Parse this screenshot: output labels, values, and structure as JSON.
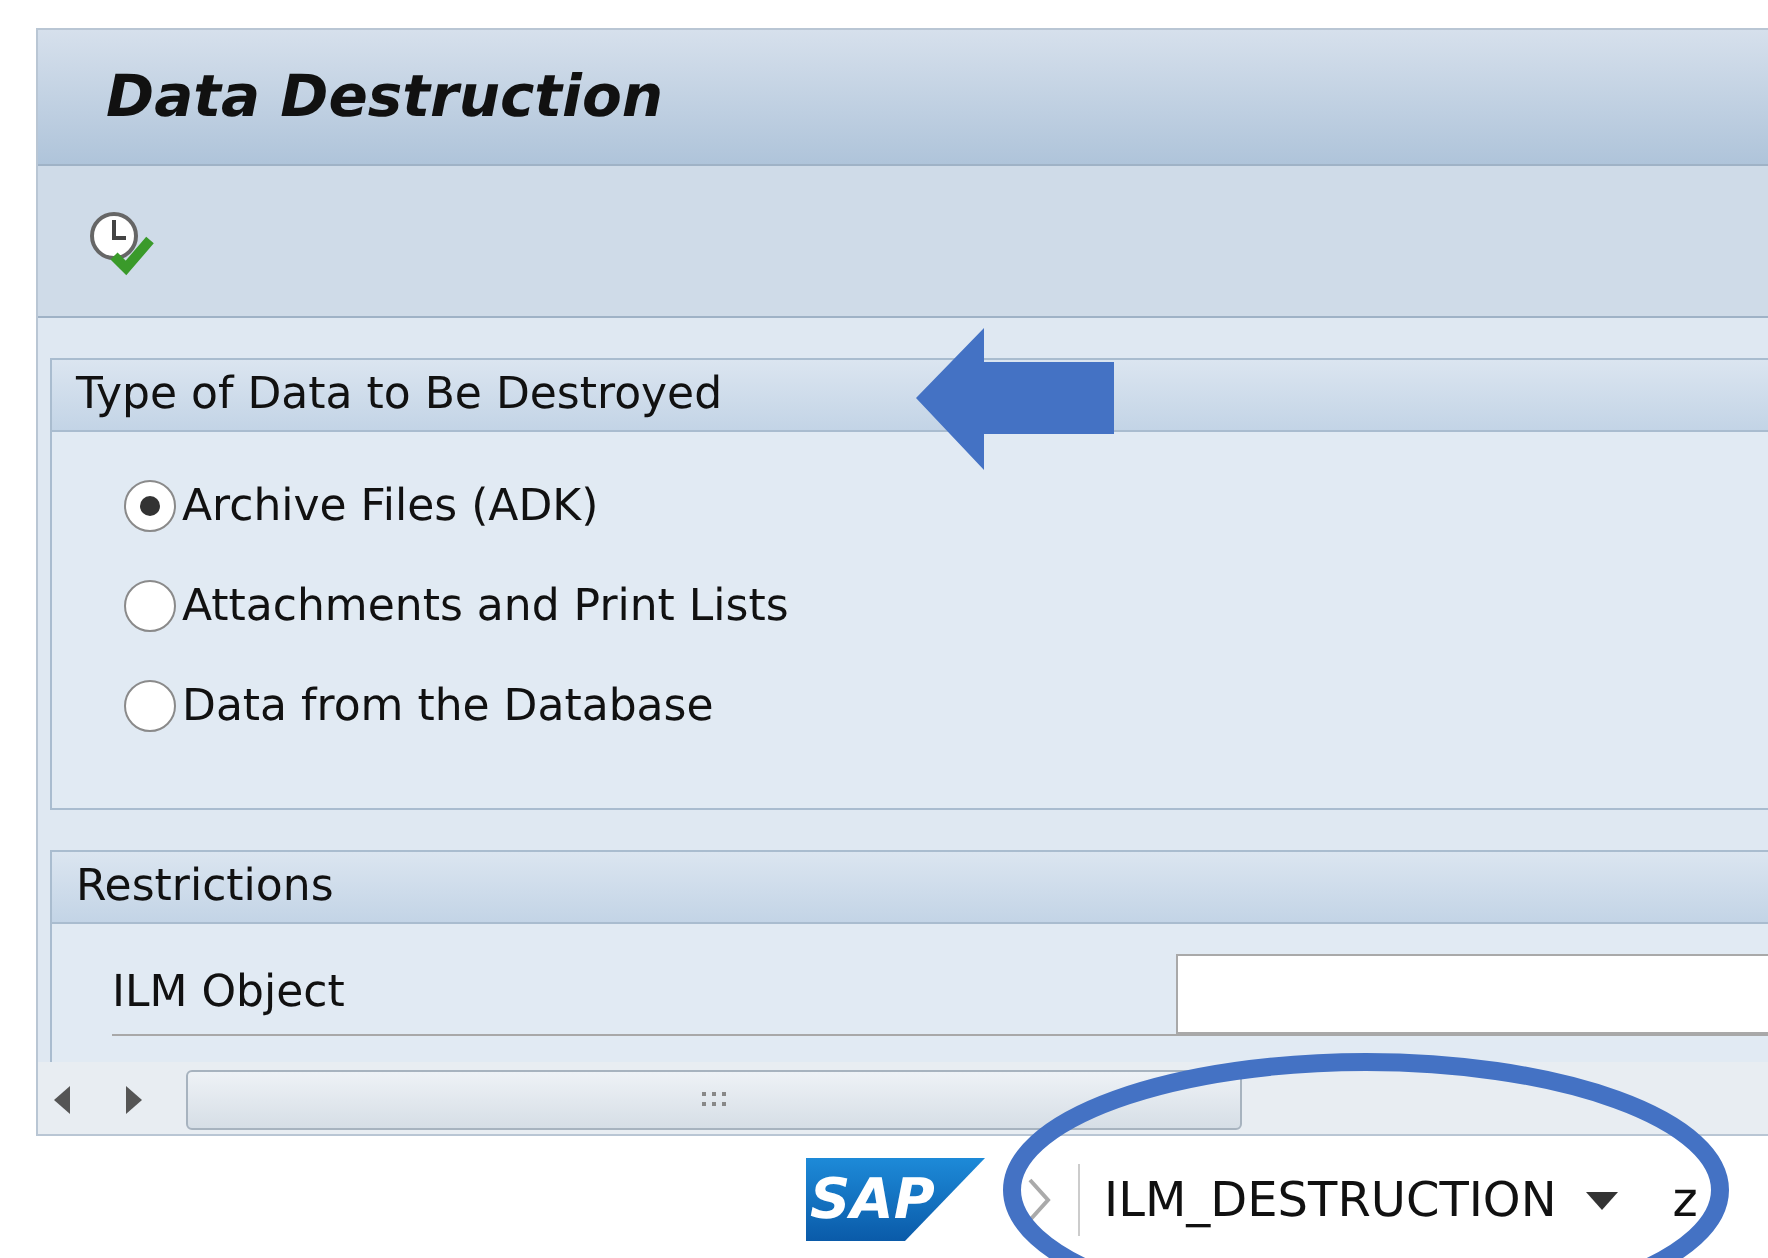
{
  "window": {
    "title": "Data Destruction"
  },
  "groups": [
    {
      "title": "Type of Data to Be Destroyed",
      "kind": "radios",
      "options": [
        {
          "label": "Archive Files (ADK)",
          "selected": true
        },
        {
          "label": "Attachments and Print Lists",
          "selected": false
        },
        {
          "label": "Data from the Database",
          "selected": false
        }
      ]
    },
    {
      "title": "Restrictions",
      "kind": "fields",
      "fields": [
        {
          "label": "ILM Object"
        }
      ]
    }
  ],
  "status_bar": {
    "logo": "SAP",
    "transaction": "ILM_DESTRUCTION",
    "extra": "z"
  }
}
